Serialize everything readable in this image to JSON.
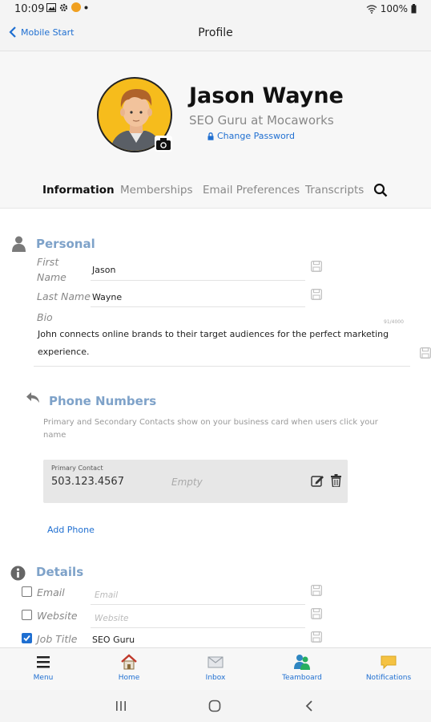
{
  "status_bar": {
    "time": "10:09",
    "battery": "100%"
  },
  "nav": {
    "back_label": "Mobile Start",
    "title": "Profile"
  },
  "profile": {
    "name": "Jason Wayne",
    "subtitle": "SEO Guru at Mocaworks",
    "change_password": "Change Password"
  },
  "tabs": [
    {
      "label": "Information"
    },
    {
      "label": "Memberships"
    },
    {
      "label": "Email Preferences"
    },
    {
      "label": "Transcripts"
    }
  ],
  "personal": {
    "title": "Personal",
    "first_name_label": "First Name",
    "first_name_value": "Jason",
    "last_name_label": "Last Name",
    "last_name_value": "Wayne",
    "bio_label": "Bio",
    "bio_value": "John connects online brands to their target audiences for the perfect marketing experience.",
    "bio_counter": "91/4000"
  },
  "phone": {
    "title": "Phone Numbers",
    "description": "Primary and Secondary Contacts show on your business card when users click your name",
    "card_label": "Primary Contact",
    "number": "503.123.4567",
    "secondary": "Empty",
    "add_label": "Add Phone"
  },
  "details": {
    "title": "Details",
    "email_label": "Email",
    "email_placeholder": "Email",
    "website_label": "Website",
    "website_placeholder": "Website",
    "job_title_label": "Job Title",
    "job_title_value": "SEO Guru"
  },
  "tabbar": [
    {
      "label": "Menu",
      "icon": "hamburger-icon"
    },
    {
      "label": "Home",
      "icon": "home-icon"
    },
    {
      "label": "Inbox",
      "icon": "inbox-icon"
    },
    {
      "label": "Teamboard",
      "icon": "teamboard-icon"
    },
    {
      "label": "Notifications",
      "icon": "notifications-icon"
    }
  ],
  "colors": {
    "accent": "#1f6fd1",
    "section_title": "#7ea2c9",
    "avatar_bg": "#f6bc1c"
  }
}
